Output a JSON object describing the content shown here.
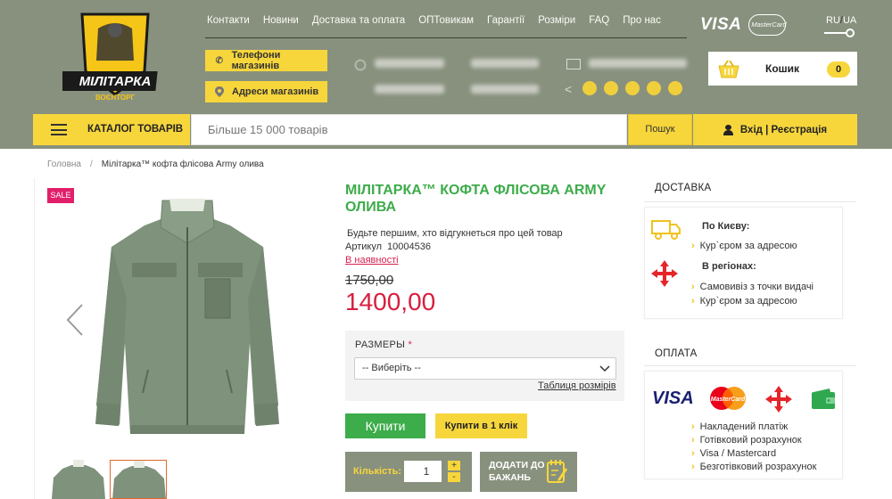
{
  "header": {
    "nav": [
      "Контакти",
      "Новини",
      "Доставка та оплата",
      "ОПТовикам",
      "Гарантії",
      "Розміри",
      "FAQ",
      "Про нас"
    ],
    "logo_text": "МІЛІТАРКА",
    "logo_subtext": "ВОЄНТОРГ",
    "phones_button": "Телефони магазинів",
    "address_button": "Адреси магазинів",
    "payment_logos": {
      "visa": "VISA",
      "mastercard": "MasterCard"
    },
    "lang": {
      "ru": "RU",
      "sep": "/",
      "ua": "UA"
    },
    "cart": {
      "label": "Кошик",
      "count": "0"
    },
    "catalog_label": "КАТАЛОГ ТОВАРІВ",
    "search_placeholder": "Більше 15 000 товарів",
    "search_button": "Пошук",
    "login_label": "Вхід | Реєстрація"
  },
  "breadcrumb": {
    "home": "Головна",
    "separator": "/",
    "current": "Мілітарка™ кофта флісова Army олива"
  },
  "product": {
    "sale_badge": "SALE",
    "title": "МІЛІТАРКА™ КОФТА ФЛІСОВА ARMY ОЛИВА",
    "reviews_text": "Будьте першим, хто відгукнеться про цей товар",
    "sku_label": "Артикул",
    "sku_value": "10004536",
    "stock_status": "В наявності",
    "old_price": "1750,00",
    "price": "1400,00",
    "sizes_label": "РАЗМЕРЫ",
    "required_mark": "*",
    "size_select_value": "-- Виберіть --",
    "size_table_link": "Таблиця розмірів",
    "buy_button": "Купити",
    "one_click_button": "Купити в 1 клік",
    "quantity_label": "Кількість:",
    "quantity_value": "1",
    "qty_plus": "+",
    "qty_minus": "-",
    "wishlist_line1": "ДОДАТИ ДО",
    "wishlist_line2": "БАЖАНЬ"
  },
  "delivery": {
    "title": "ДОСТАВКА",
    "kyiv_heading": "По Києву:",
    "kyiv_items": [
      "Кур`єром за адресою"
    ],
    "regions_heading": "В регіонах:",
    "regions_items": [
      "Самовивіз з точки видачі",
      "Кур`єром за адресою"
    ]
  },
  "payment": {
    "title": "ОПЛАТА",
    "logo_visa": "VISA",
    "logo_mastercard": "MasterCard",
    "items": [
      "Накладений платіж",
      "Готівковий розрахунок",
      "Visa / Mastercard",
      "Безготівковий розрахунок"
    ]
  },
  "icons": {
    "chevron": "›",
    "select_arrow": "⌵"
  },
  "colors": {
    "header_bg": "#88917e",
    "accent_yellow": "#f7d63c",
    "title_green": "#3dac4a",
    "price_red": "#d81e3e",
    "sale_pink": "#e11f6a"
  }
}
